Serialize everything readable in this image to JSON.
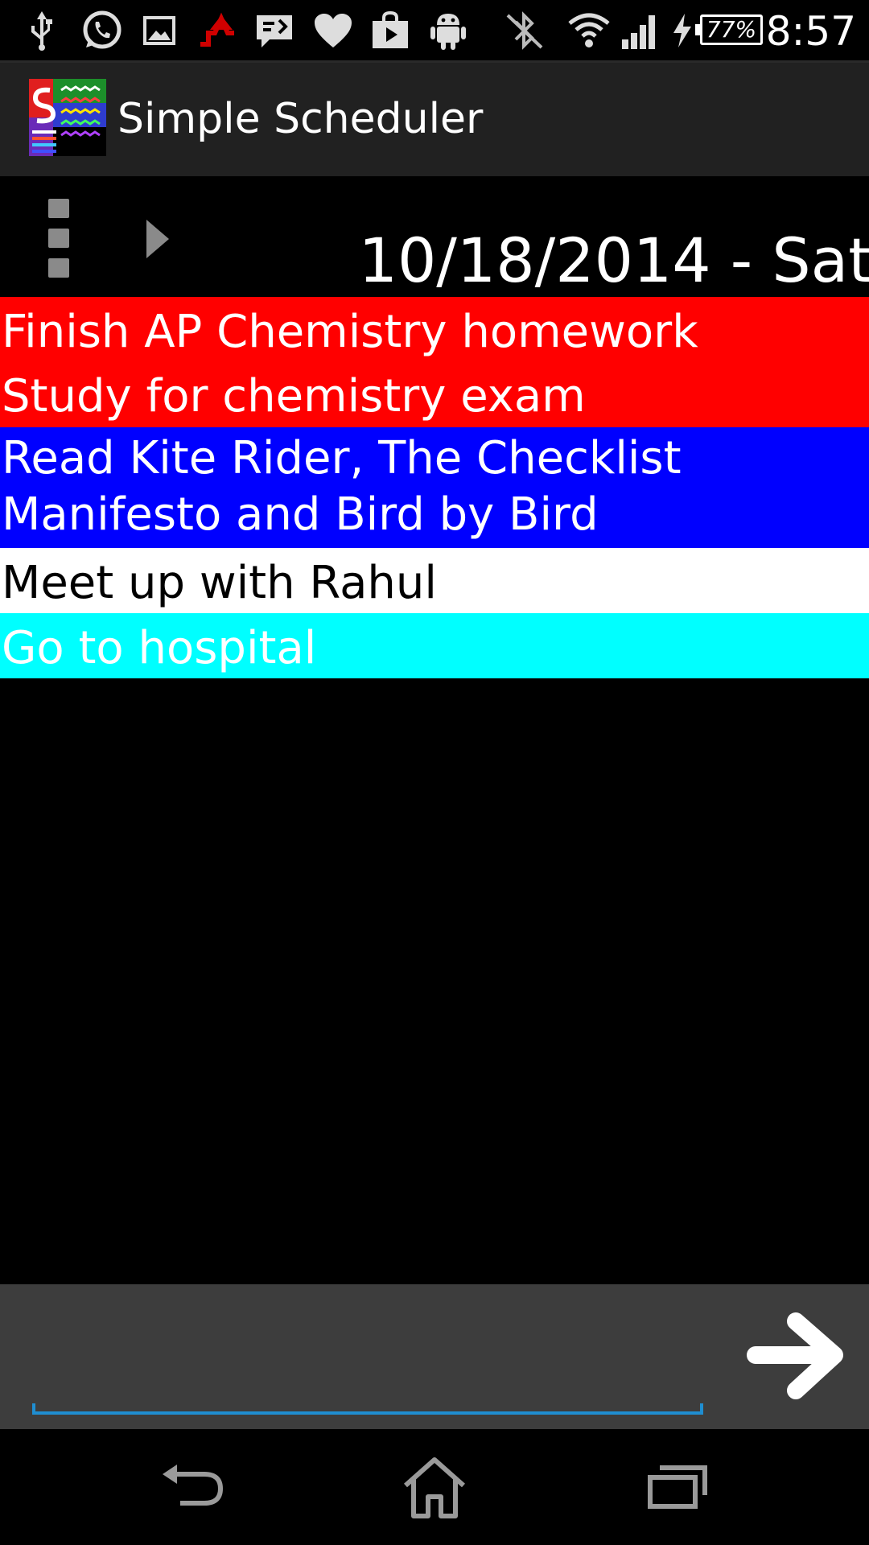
{
  "status_bar": {
    "icons": [
      "usb-icon",
      "whatsapp-icon",
      "gallery-icon",
      "upload-icon",
      "message-icon",
      "heart-icon",
      "play-store-icon",
      "android-icon",
      "bluetooth-off-icon",
      "wifi-icon",
      "signal-icon",
      "charging-icon"
    ],
    "battery": "77%",
    "time": "8:57"
  },
  "app_bar": {
    "title": "Simple Scheduler",
    "logo_icon": "app-logo-icon"
  },
  "toolbar": {
    "menu_icon": "overflow-menu-icon",
    "next_icon": "next-arrow-icon",
    "date": "10/18/2014 - Sat"
  },
  "tasks": [
    {
      "text": "Finish AP Chemistry homework\nStudy for chemistry exam",
      "color": "#ff0000"
    },
    {
      "text": "Read Kite Rider, The Checklist\nManifesto and Bird by Bird",
      "color": "#0000ff"
    },
    {
      "text": "Meet up with Rahul",
      "color": "#ffffff"
    },
    {
      "text": "Go to hospital",
      "color": "#00ffff"
    }
  ],
  "input": {
    "value": "",
    "placeholder": "",
    "submit_icon": "right-arrow-icon",
    "accent": "#1f8ed1"
  },
  "nav_bar": {
    "buttons": [
      "back-icon",
      "home-icon",
      "recent-apps-icon"
    ]
  }
}
